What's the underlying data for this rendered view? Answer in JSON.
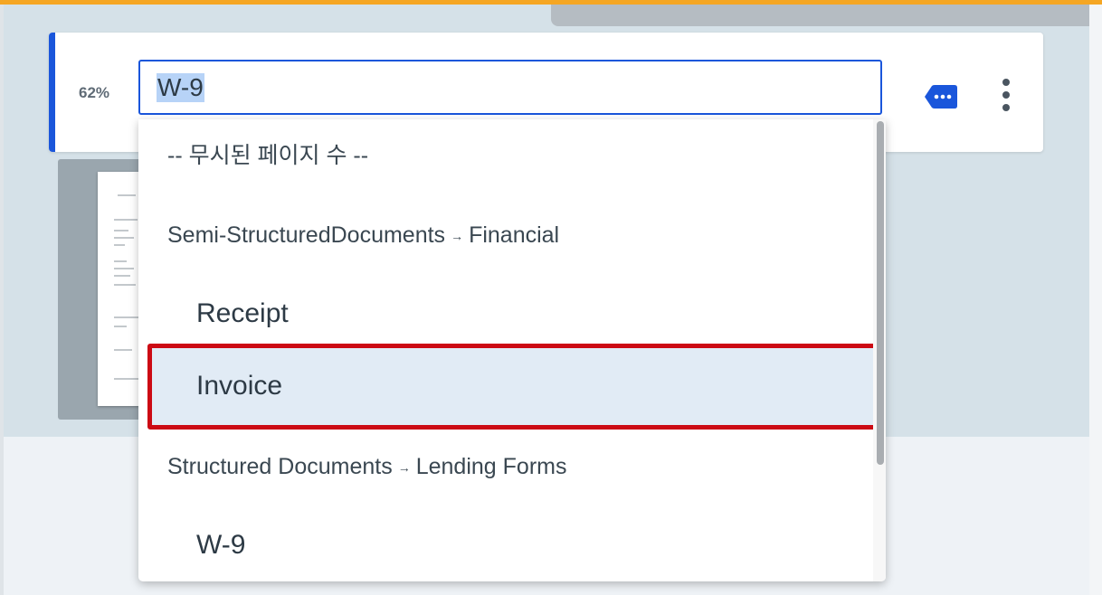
{
  "card": {
    "confidence": "62%",
    "document_type_input": {
      "value": "W-9"
    }
  },
  "dropdown": {
    "placeholder": "-- 무시된 페이지 수 --",
    "groups": [
      {
        "parent": "Semi-StructuredDocuments",
        "arrow": "→",
        "child": "Financial",
        "options": [
          "Receipt",
          "Invoice"
        ]
      },
      {
        "parent": "Structured Documents",
        "arrow": "→",
        "child": "Lending Forms",
        "options": [
          "W-9"
        ]
      }
    ],
    "highlighted_option": "Invoice"
  },
  "colors": {
    "accent": "#1a56db",
    "highlight_border": "#cc0a14",
    "highlight_bg": "#e1ebf5"
  },
  "icons": {
    "label": "label-tag-icon",
    "more": "more-vertical-icon"
  }
}
